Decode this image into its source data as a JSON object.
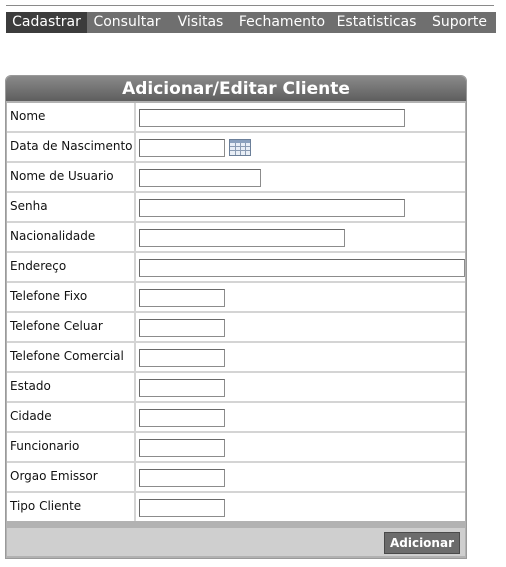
{
  "menu": {
    "items": [
      {
        "label": "Cadastrar",
        "active": true
      },
      {
        "label": "Consultar",
        "active": false
      },
      {
        "label": "Visitas",
        "active": false
      },
      {
        "label": "Fechamento",
        "active": false
      },
      {
        "label": "Estatisticas",
        "active": false
      },
      {
        "label": "Suporte",
        "active": false
      }
    ]
  },
  "form": {
    "title": "Adicionar/Editar Cliente",
    "fields": [
      {
        "label": "Nome",
        "value": ""
      },
      {
        "label": "Data de Nascimento",
        "value": ""
      },
      {
        "label": "Nome de Usuario",
        "value": ""
      },
      {
        "label": "Senha",
        "value": ""
      },
      {
        "label": "Nacionalidade",
        "value": ""
      },
      {
        "label": "Endereço",
        "value": ""
      },
      {
        "label": "Telefone Fixo",
        "value": ""
      },
      {
        "label": "Telefone Celuar",
        "value": ""
      },
      {
        "label": "Telefone Comercial",
        "value": ""
      },
      {
        "label": "Estado",
        "value": ""
      },
      {
        "label": "Cidade",
        "value": ""
      },
      {
        "label": "Funcionario",
        "value": ""
      },
      {
        "label": "Orgao Emissor",
        "value": ""
      },
      {
        "label": "Tipo Cliente",
        "value": ""
      }
    ],
    "calendar_icon": "calendar-icon",
    "submit_label": "Adicionar"
  },
  "colors": {
    "menu_bg": "#6f6f6f",
    "menu_active_bg": "#3c3c3c",
    "panel_header": "#6e6e6e",
    "button_bg": "#6c6c6c"
  }
}
